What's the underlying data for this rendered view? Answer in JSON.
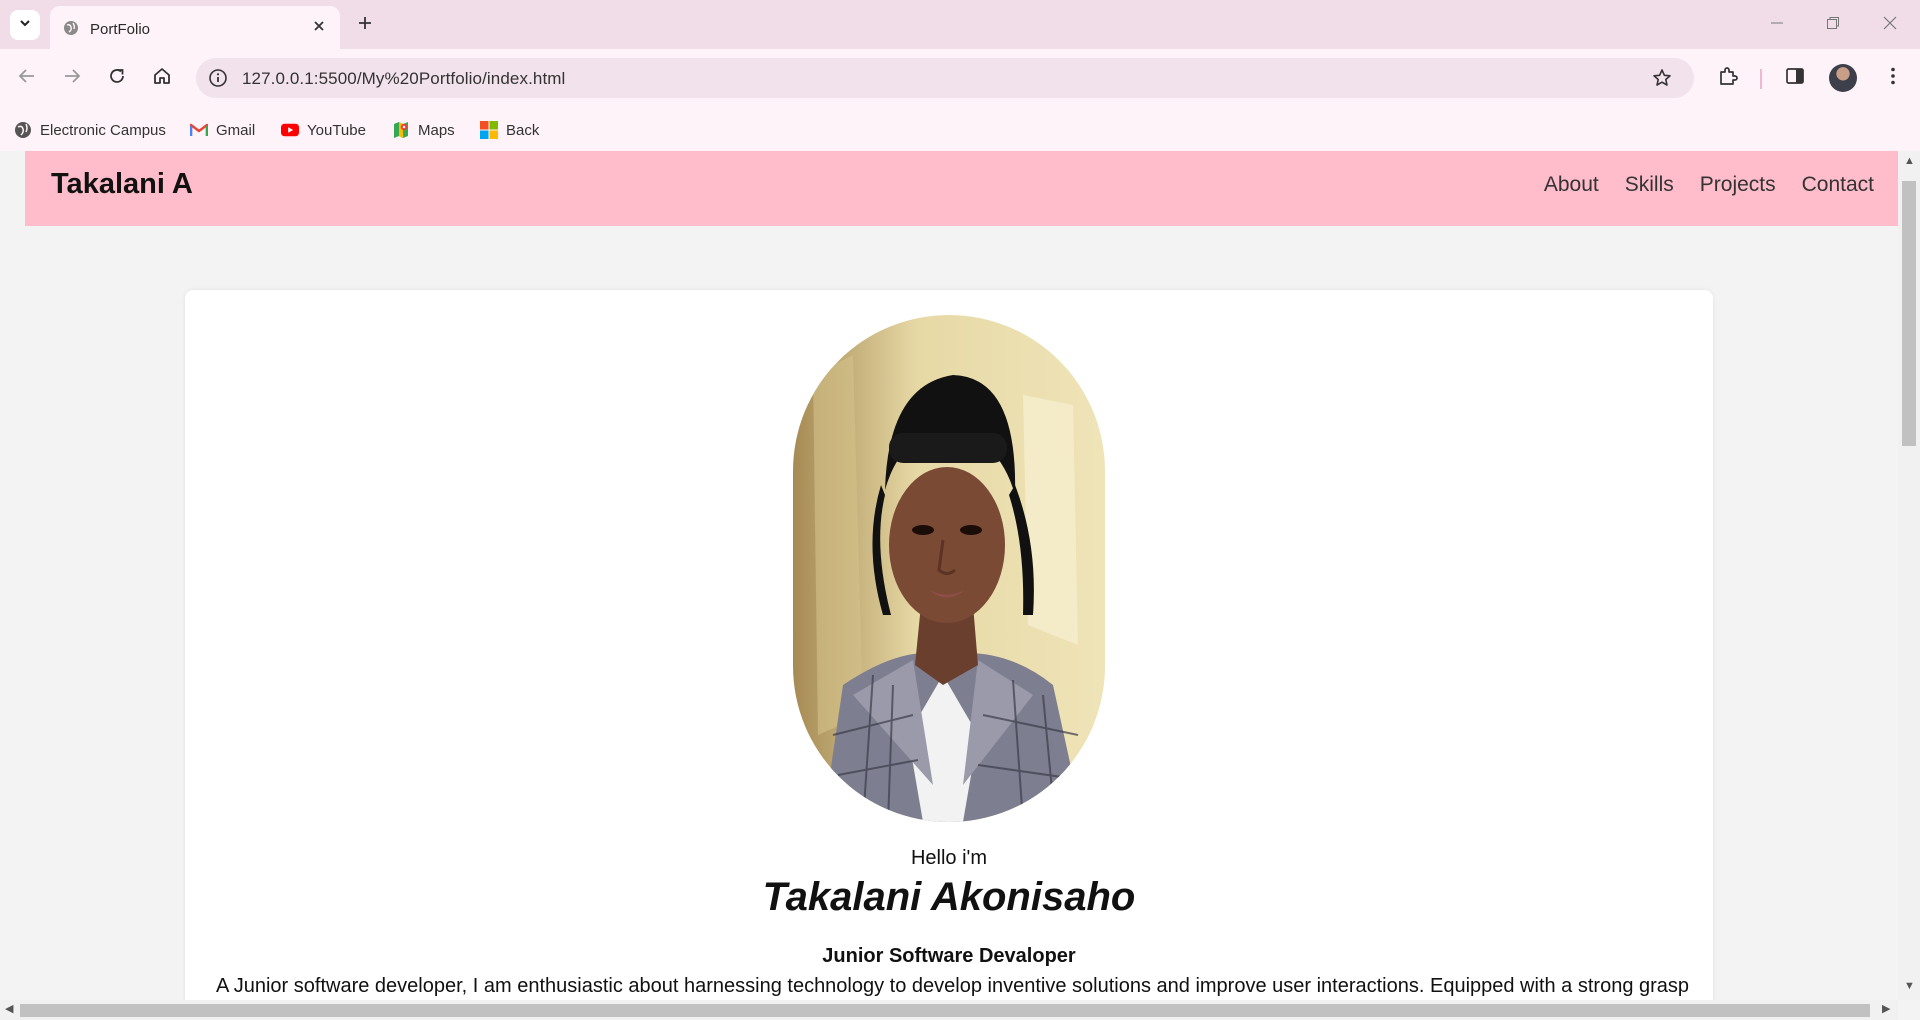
{
  "browser": {
    "tab": {
      "title": "PortFolio",
      "favicon": "globe-icon"
    },
    "address": {
      "url": "127.0.0.1:5500/My%20Portfolio/index.html"
    },
    "bookmarks": [
      {
        "label": "Electronic Campus",
        "icon": "globe-icon"
      },
      {
        "label": "Gmail",
        "icon": "gmail-icon"
      },
      {
        "label": "YouTube",
        "icon": "youtube-icon"
      },
      {
        "label": "Maps",
        "icon": "maps-icon"
      },
      {
        "label": "Back",
        "icon": "microsoft-icon"
      }
    ],
    "colors": {
      "tabbar": "#f0dde8",
      "toolbar": "#fdf3f8"
    }
  },
  "site": {
    "logo": "Takalani A",
    "nav": [
      "About",
      "Skills",
      "Projects",
      "Contact"
    ],
    "hero": {
      "greeting": "Hello i'm",
      "name": "Takalani Akonisaho",
      "role": "Junior Software Devaloper",
      "bio": "A Junior software developer, I am enthusiastic about harnessing technology to develop inventive solutions and improve user interactions. Equipped with a strong grasp"
    },
    "colors": {
      "header": "#ffbccb",
      "background": "#f3f3f3",
      "card": "#ffffff"
    }
  }
}
